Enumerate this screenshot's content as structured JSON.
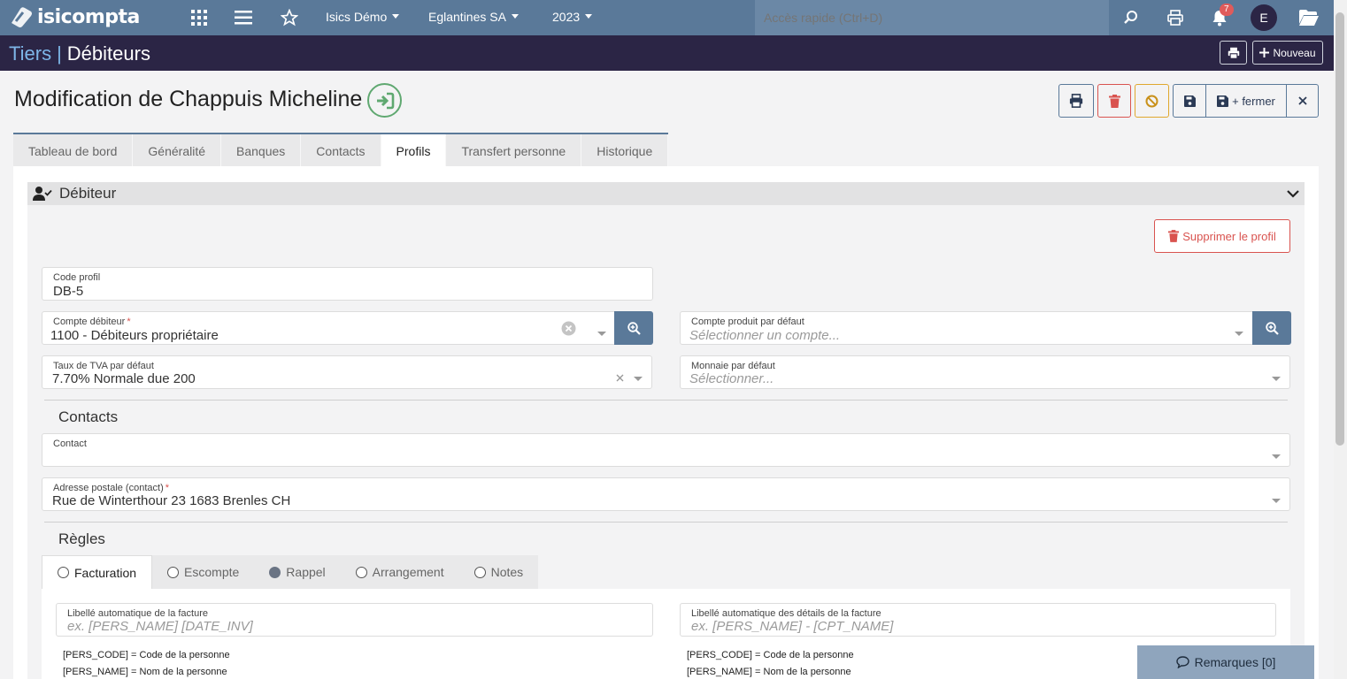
{
  "topbar": {
    "logo_text": "isicompta",
    "company_menu": "Isics Démo",
    "entity_menu": "Eglantines SA",
    "year_menu": "2023",
    "quick_placeholder": "Accès rapide (Ctrl+D)",
    "notification_count": "7",
    "avatar_initial": "E",
    "bg_color": "#5a7999"
  },
  "titlebar": {
    "crumb_parent": "Tiers",
    "crumb_separator": "|",
    "crumb_current": "Débiteurs",
    "new_label": "Nouveau"
  },
  "page": {
    "heading": "Modification de Chappuis Micheline",
    "save_close_label": "+ fermer"
  },
  "tabs": [
    {
      "label": "Tableau de bord",
      "active": false
    },
    {
      "label": "Généralité",
      "active": false
    },
    {
      "label": "Banques",
      "active": false
    },
    {
      "label": "Contacts",
      "active": false
    },
    {
      "label": "Profils",
      "active": true
    },
    {
      "label": "Transfert personne",
      "active": false
    },
    {
      "label": "Historique",
      "active": false
    }
  ],
  "section": {
    "title": "Débiteur",
    "delete_profile_label": "Supprimer le profil"
  },
  "fields": {
    "code_profil": {
      "label": "Code profil",
      "value": "DB-5"
    },
    "compte_debiteur": {
      "label": "Compte débiteur",
      "required": "*",
      "value": "1100 - Débiteurs propriétaire"
    },
    "compte_produit": {
      "label": "Compte produit par défaut",
      "placeholder": "Sélectionner un compte..."
    },
    "taux_tva": {
      "label": "Taux de TVA par défaut",
      "value": "7.70% Normale due 200"
    },
    "monnaie": {
      "label": "Monnaie par défaut",
      "placeholder": "Sélectionner..."
    },
    "contact": {
      "label": "Contact",
      "value": ""
    },
    "adresse": {
      "label": "Adresse postale (contact)",
      "required": "*",
      "value": "Rue de Winterthour 23 1683 Brenles CH"
    }
  },
  "contacts_heading": "Contacts",
  "regles_heading": "Règles",
  "rule_tabs": [
    {
      "label": "Facturation",
      "active": true,
      "checked": false
    },
    {
      "label": "Escompte",
      "active": false,
      "checked": false
    },
    {
      "label": "Rappel",
      "active": false,
      "checked": true
    },
    {
      "label": "Arrangement",
      "active": false,
      "checked": false
    },
    {
      "label": "Notes",
      "active": false,
      "checked": false
    }
  ],
  "facturation": {
    "libelle_facture": {
      "label": "Libellé automatique de la facture",
      "placeholder": "ex. [PERS_NAME] [DATE_INV]"
    },
    "libelle_details": {
      "label": "Libellé automatique des détails de la facture",
      "placeholder": "ex. [PERS_NAME] - [CPT_NAME]"
    },
    "help_left": [
      "[PERS_CODE] = Code de la personne",
      "[PERS_NAME] = Nom de la personne"
    ],
    "help_right": [
      "[PERS_CODE] = Code de la personne",
      "[PERS_NAME] = Nom de la personne"
    ]
  },
  "remarks": {
    "label": "Remarques [0]"
  }
}
